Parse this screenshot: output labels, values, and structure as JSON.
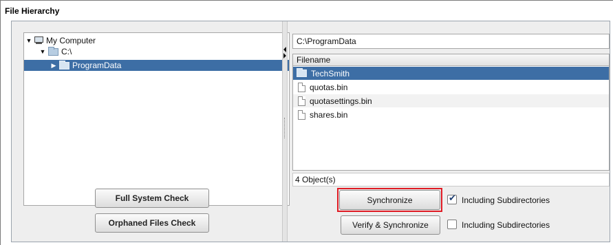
{
  "window": {
    "title": "File Hierarchy"
  },
  "tree": {
    "items": [
      {
        "label": "My Computer",
        "expanded": true,
        "icon": "computer-icon"
      },
      {
        "label": "C:\\",
        "expanded": true,
        "icon": "folder-icon"
      },
      {
        "label": "ProgramData",
        "expanded": false,
        "selected": true,
        "icon": "folder-icon"
      }
    ]
  },
  "left_buttons": {
    "full_check": "Full System Check",
    "orphaned_check": "Orphaned Files Check"
  },
  "path": {
    "value": "C:\\ProgramData"
  },
  "file_list": {
    "header": "Filename",
    "rows": [
      {
        "name": "TechSmith",
        "type": "folder",
        "selected": true
      },
      {
        "name": "quotas.bin",
        "type": "file"
      },
      {
        "name": "quotasettings.bin",
        "type": "file"
      },
      {
        "name": "shares.bin",
        "type": "file"
      }
    ]
  },
  "status": {
    "count_text": "4 Object(s)"
  },
  "actions": {
    "synchronize": "Synchronize",
    "verify_synchronize": "Verify & Synchronize",
    "subdirs_label_1": "Including Subdirectories",
    "subdirs_label_2": "Including Subdirectories",
    "subdirs_checked_1": true,
    "subdirs_checked_2": false
  },
  "colors": {
    "selection": "#3d6ea5",
    "highlight": "#e01b24"
  }
}
